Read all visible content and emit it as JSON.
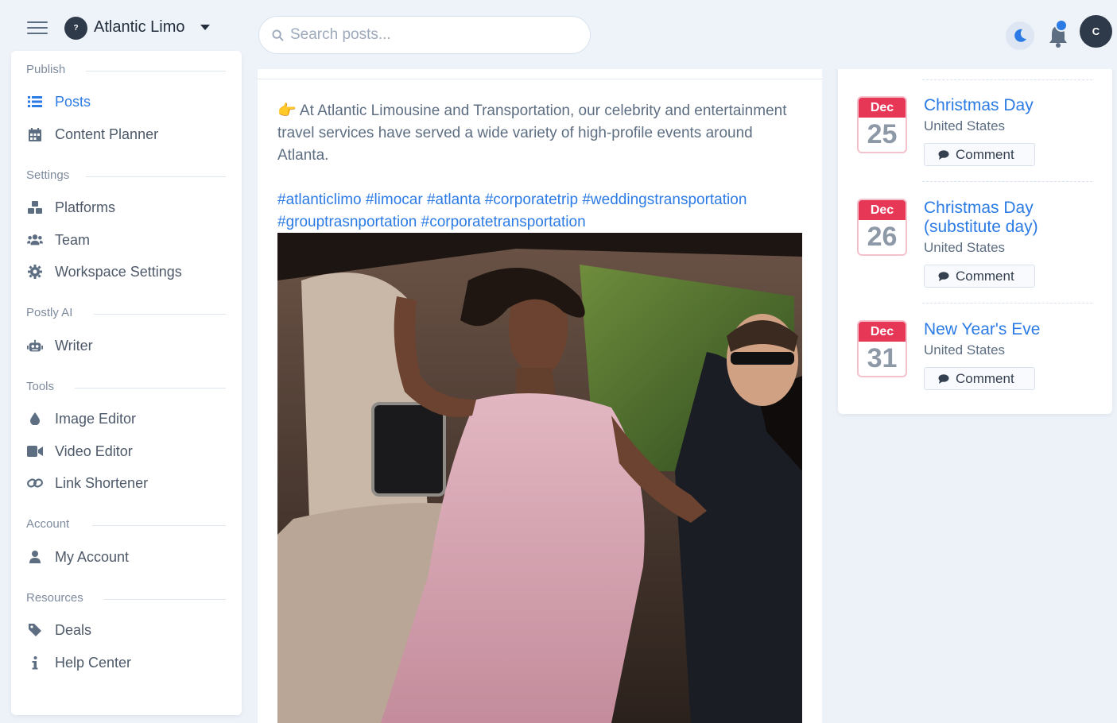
{
  "workspace": {
    "name": "Atlantic Limo",
    "logo_text": "?"
  },
  "search": {
    "placeholder": "Search posts..."
  },
  "user": {
    "avatar_initial": "C"
  },
  "sidebar": {
    "sections": [
      {
        "title": "Publish",
        "items": [
          {
            "label": "Posts",
            "icon": "list-icon",
            "active": true
          },
          {
            "label": "Content Planner",
            "icon": "calendar-icon"
          }
        ]
      },
      {
        "title": "Settings",
        "items": [
          {
            "label": "Platforms",
            "icon": "cubes-icon"
          },
          {
            "label": "Team",
            "icon": "users-icon"
          },
          {
            "label": "Workspace Settings",
            "icon": "gear-icon"
          }
        ]
      },
      {
        "title": "Postly AI",
        "items": [
          {
            "label": "Writer",
            "icon": "robot-icon"
          }
        ]
      },
      {
        "title": "Tools",
        "items": [
          {
            "label": "Image Editor",
            "icon": "droplet-icon"
          },
          {
            "label": "Video Editor",
            "icon": "video-icon"
          },
          {
            "label": "Link Shortener",
            "icon": "link-icon"
          }
        ]
      },
      {
        "title": "Account",
        "items": [
          {
            "label": "My Account",
            "icon": "user-icon"
          }
        ]
      },
      {
        "title": "Resources",
        "items": [
          {
            "label": "Deals",
            "icon": "tag-icon"
          },
          {
            "label": "Help Center",
            "icon": "info-icon"
          }
        ]
      }
    ]
  },
  "post": {
    "emoji": "👉",
    "text": "At Atlantic Limousine and Transportation, our celebrity and entertainment travel services have served a wide variety of high-profile events around Atlanta.",
    "hashtags": "#atlanticlimo #limocar #atlanta #corporatetrip #weddingstransportation #grouptrasnportation #corporatetransportation"
  },
  "holidays": [
    {
      "month": "Dec",
      "day": "25",
      "name": "Christmas Day",
      "country": "United States",
      "comment_label": "Comment"
    },
    {
      "month": "Dec",
      "day": "26",
      "name": "Christmas Day (substitute day)",
      "country": "United States",
      "comment_label": "Comment"
    },
    {
      "month": "Dec",
      "day": "31",
      "name": "New Year's Eve",
      "country": "United States",
      "comment_label": "Comment"
    }
  ],
  "colors": {
    "primary": "#2c7be5",
    "danger": "#e63757",
    "background": "#edf2f9",
    "text": "#344050"
  }
}
